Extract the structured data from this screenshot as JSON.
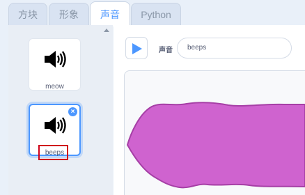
{
  "tabs": [
    {
      "label": "方块",
      "active": false
    },
    {
      "label": "形象",
      "active": false
    },
    {
      "label": "声音",
      "active": true
    },
    {
      "label": "Python",
      "active": false
    }
  ],
  "sounds": [
    {
      "name": "meow",
      "selected": false,
      "icon": "speaker-icon"
    },
    {
      "name": "beeps",
      "selected": true,
      "icon": "speaker-icon"
    }
  ],
  "editor": {
    "name_label": "声音",
    "name_value": "beeps"
  },
  "colors": {
    "accent": "#4c97ff",
    "waveform_fill": "#cf63cf",
    "waveform_stroke": "#a63fa6",
    "highlight": "#d0021b"
  }
}
